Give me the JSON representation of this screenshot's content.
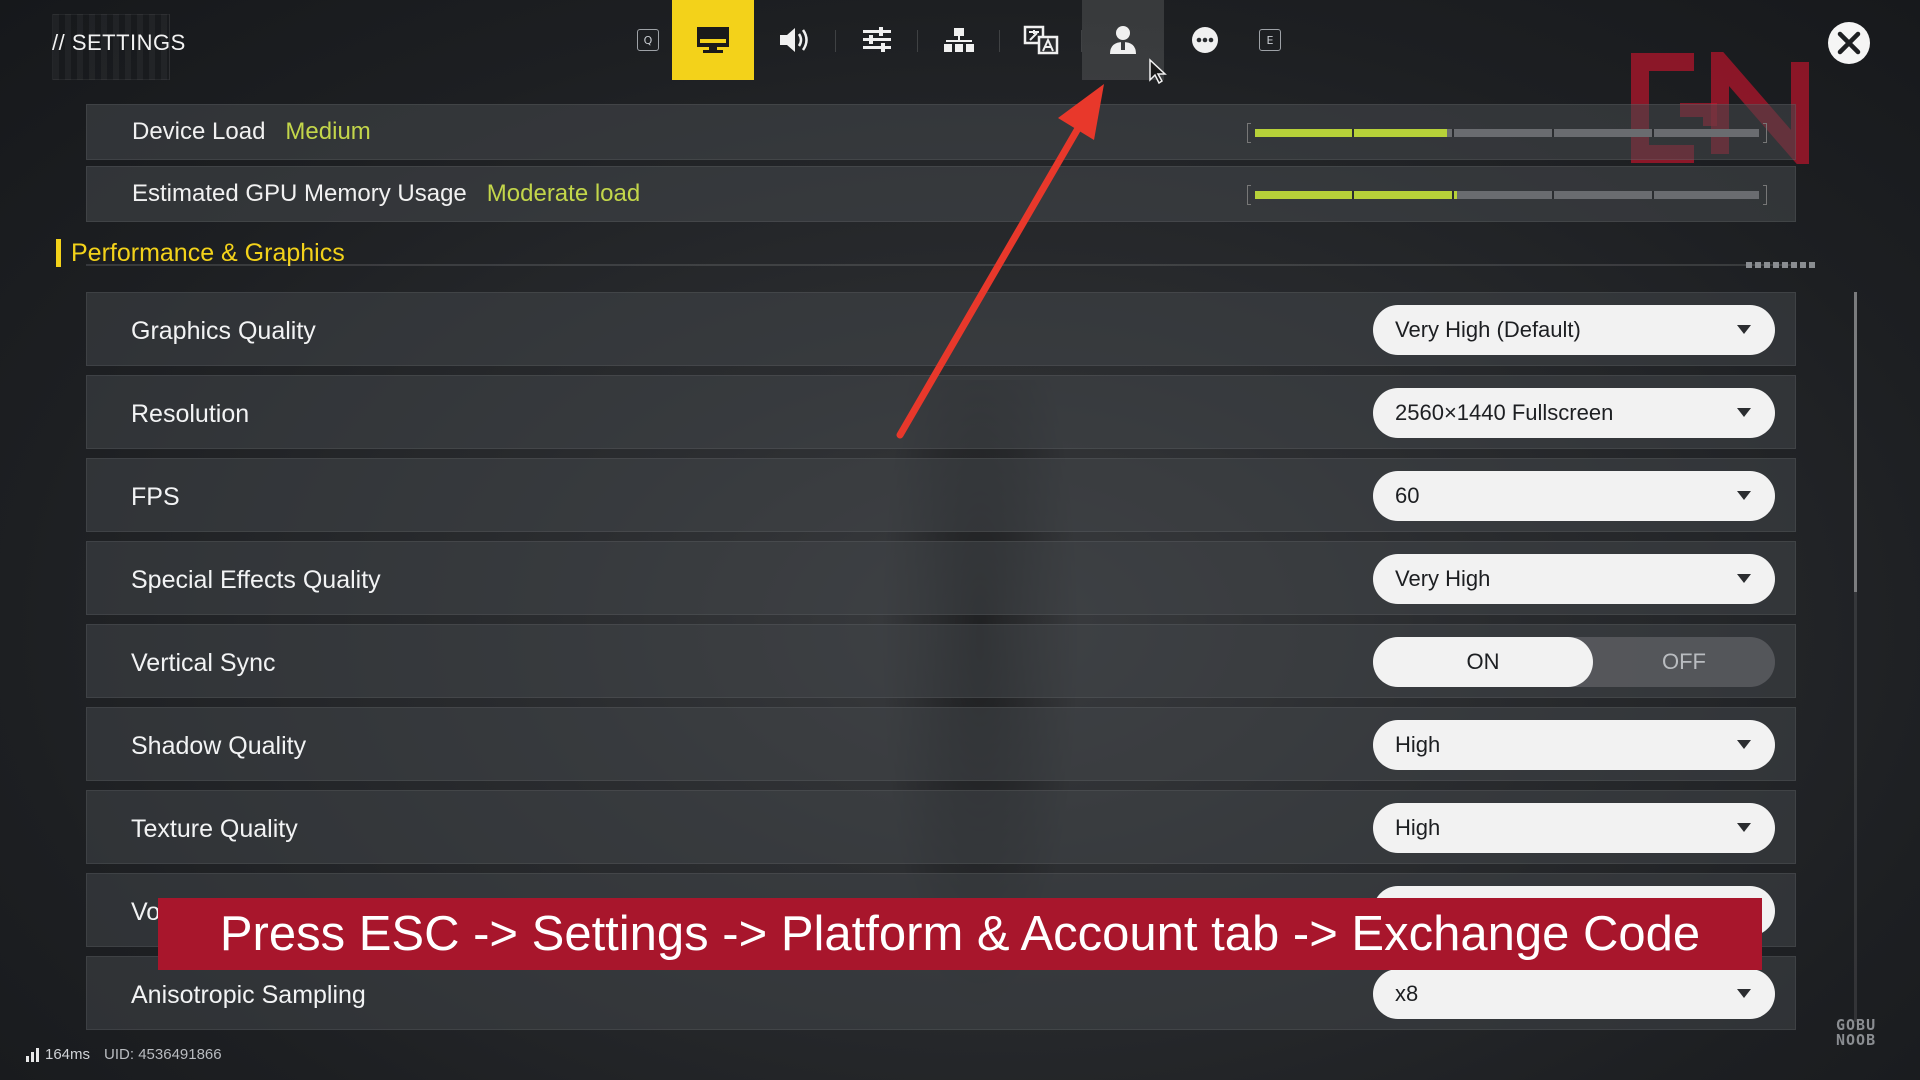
{
  "header": {
    "title": "// SETTINGS",
    "tabs": [
      {
        "name": "tab-key-q",
        "key": "Q"
      },
      {
        "name": "tab-display",
        "icon": "monitor-icon",
        "active": true
      },
      {
        "name": "tab-audio",
        "icon": "speaker-icon"
      },
      {
        "name": "tab-controls",
        "icon": "sliders-icon"
      },
      {
        "name": "tab-network",
        "icon": "network-icon"
      },
      {
        "name": "tab-language",
        "icon": "translate-icon"
      },
      {
        "name": "tab-account",
        "icon": "user-icon",
        "hovered": true
      },
      {
        "name": "tab-other",
        "icon": "more-icon"
      },
      {
        "name": "tab-key-e",
        "key": "E"
      }
    ],
    "close_icon": "close-icon"
  },
  "load": {
    "device_label": "Device Load",
    "device_value": "Medium",
    "device_level": 0.38,
    "gpu_label": "Estimated GPU Memory Usage",
    "gpu_value": "Moderate load",
    "gpu_level": 0.4
  },
  "section": {
    "title": "Performance & Graphics"
  },
  "settings": {
    "graphics_quality": {
      "label": "Graphics Quality",
      "value": "Very High (Default)"
    },
    "resolution": {
      "label": "Resolution",
      "value": "2560×1440 Fullscreen"
    },
    "fps": {
      "label": "FPS",
      "value": "60"
    },
    "special_effects": {
      "label": "Special Effects Quality",
      "value": "Very High"
    },
    "vertical_sync": {
      "label": "Vertical Sync",
      "on_label": "ON",
      "off_label": "OFF",
      "selected": "ON"
    },
    "shadow_quality": {
      "label": "Shadow Quality",
      "value": "High"
    },
    "texture_quality": {
      "label": "Texture Quality",
      "value": "High"
    },
    "partial_row": {
      "label": "Vo",
      "value": ""
    },
    "anisotropic": {
      "label": "Anisotropic Sampling",
      "value": "x8"
    }
  },
  "caption": {
    "text": "Press ESC -> Settings -> Platform & Account tab -> Exchange Code"
  },
  "footer": {
    "ping": "164ms",
    "uid": "UID: 4536491866"
  },
  "brand": {
    "line1": "GOBU",
    "line2": "NOOB"
  },
  "colors": {
    "accent": "#f3d21a",
    "load_value": "#c3d64a",
    "caption_bg": "#a8162c",
    "arrow": "#e8382b"
  }
}
